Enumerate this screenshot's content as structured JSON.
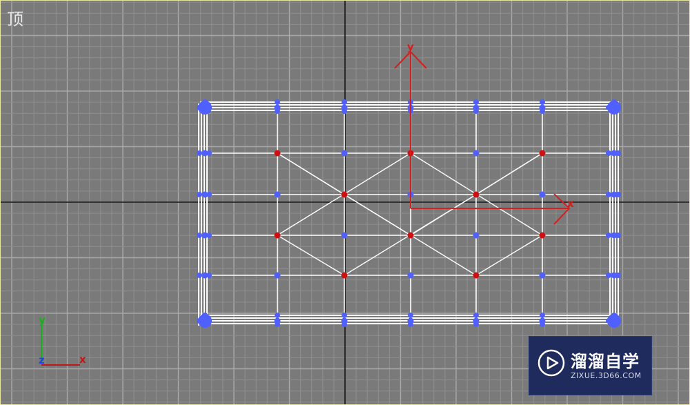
{
  "viewport": {
    "label": "顶",
    "background_color": "#7a7a7a",
    "grid_minor_color": "#8e8e8e",
    "grid_major_color": "#a8a8a8",
    "world_axis_color": "#101010",
    "border_color": "#e6e6a0"
  },
  "mesh": {
    "edge_color": "#ffffff",
    "vertex_color": "#5060ff",
    "selected_vertex_color": "#d01010"
  },
  "gizmo": {
    "color": "#d02020",
    "x_label": "x",
    "y_label": "y"
  },
  "axis_tripod": {
    "x_label": "x",
    "y_label": "y",
    "z_label": "z",
    "x_color": "#c01818",
    "y_color": "#18b018",
    "z_color": "#2040ff"
  },
  "watermark": {
    "brand": "溜溜自学",
    "url": "ZIXUE.3D66.COM",
    "background": "#1f2b5c",
    "icon": "play-logo-icon"
  }
}
